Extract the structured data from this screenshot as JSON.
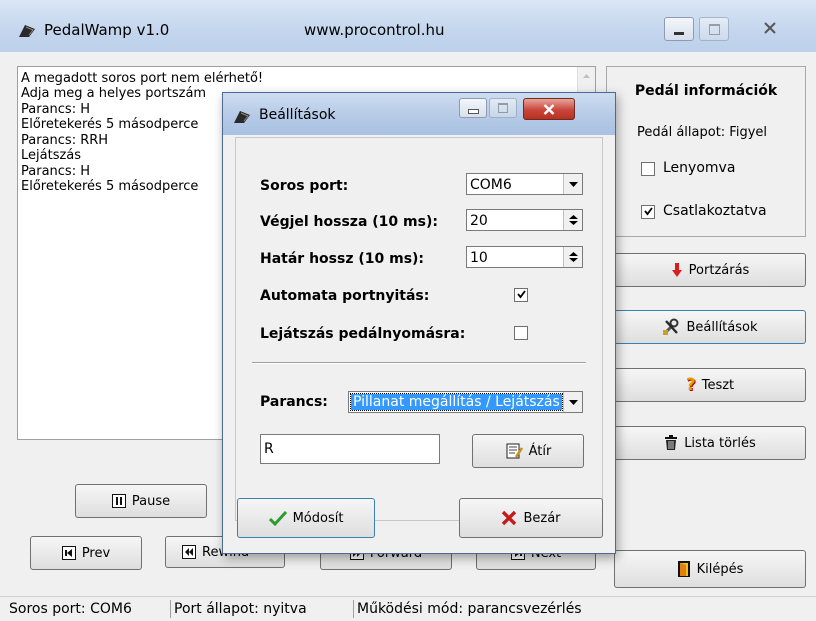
{
  "main_window": {
    "app_title": "PedalWamp v1.0",
    "url_title": "www.procontrol.hu"
  },
  "log": {
    "lines": [
      "A megadott soros port nem elérhető!",
      "Adja meg a helyes portszám",
      "Parancs: H",
      "Előretekerés 5 másodperce",
      "Parancs: RRH",
      "Lejátszás",
      "Parancs: H",
      "Előretekerés 5 másodperce"
    ]
  },
  "info_panel": {
    "title": "Pedál információk",
    "state_label": "Pedál állapot: Figyel",
    "pressed_label": "Lenyomva",
    "pressed_checked": false,
    "connected_label": "Csatlakoztatva",
    "connected_checked": true
  },
  "side_buttons": {
    "port_close": "Portzárás",
    "settings": "Beállítások",
    "test": "Teszt",
    "clear_list": "Lista törlés",
    "exit": "Kilépés"
  },
  "transport": {
    "pause": "Pause",
    "prev": "Prev",
    "rewind": "Rewind",
    "forward": "Forward",
    "next": "Next"
  },
  "statusbar": {
    "port": "Soros port: COM6",
    "port_state": "Port állapot: nyitva",
    "mode": "Működési mód: parancsvezérlés"
  },
  "settings_dialog": {
    "title": "Beállítások",
    "serial_port_label": "Soros port:",
    "serial_port_value": "COM6",
    "endmark_label": "Végjel hossza (10 ms):",
    "endmark_value": "20",
    "limit_label": "Határ hossz (10 ms):",
    "limit_value": "10",
    "auto_open_label": "Automata portnyitás:",
    "auto_open_checked": true,
    "play_on_press_label": "Lejátszás pedálnyomásra:",
    "play_on_press_checked": false,
    "command_label": "Parancs:",
    "command_value": "Pillanat megállítás / Lejátszás",
    "code_value": "R",
    "rewrite_button": "Átír",
    "modify_button": "Módosít",
    "close_button": "Bezár"
  },
  "colors": {
    "titlebar": "#c4d6ee",
    "close_red": "#c9463d",
    "select_blue": "#3399ff",
    "check_mark": "#000000",
    "ok_green": "#2c9a2c",
    "cancel_red": "#c31b1b"
  }
}
